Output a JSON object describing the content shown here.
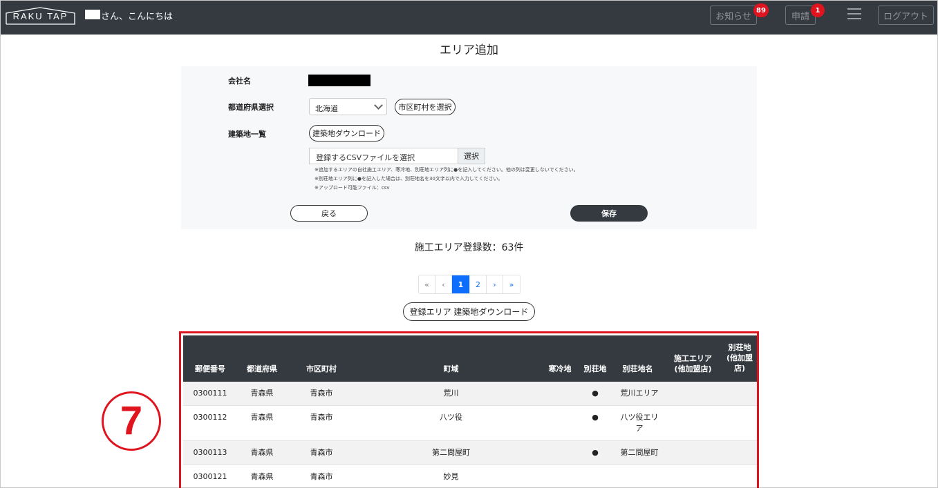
{
  "header": {
    "logo": "RAKU TAP",
    "greeting": "さん、こんにちは",
    "notice_label": "お知らせ",
    "notice_count": "89",
    "apply_label": "申請",
    "apply_count": "1",
    "logout_label": "ログアウト"
  },
  "page_title": "エリア追加",
  "form": {
    "company_label": "会社名",
    "prefecture_label": "都道府県選択",
    "prefecture_value": "北海道",
    "city_button": "市区町村を選択",
    "building_label": "建築地一覧",
    "building_download_button": "建築地ダウンロード",
    "file_placeholder": "登録するCSVファイルを選択",
    "file_button": "選択",
    "notes": [
      "※追加するエリアの自社施工エリア、寒冷地、別荘地エリア列に●を記入してください。他の列は変更しないでください。",
      "※別荘地エリア列に●を記入した場合は、別荘地名を30文字以内で入力してください。",
      "※アップロード可能ファイル：csv"
    ],
    "back_button": "戻る",
    "save_button": "保存"
  },
  "count_text": "施工エリア登録数：63件",
  "pagination": [
    "«",
    "‹",
    "1",
    "2",
    "›",
    "»"
  ],
  "pagination_active": "1",
  "download_registered_button": "登録エリア 建築地ダウンロード",
  "table": {
    "headers": [
      "郵便番号",
      "都道府県",
      "市区町村",
      "町域",
      "寒冷地",
      "別荘地",
      "別荘地名",
      "施工エリア\n(他加盟店)",
      "別荘地\n(他加盟\n店)"
    ],
    "rows": [
      {
        "zip": "0300111",
        "pref": "青森県",
        "city": "青森市",
        "town": "荒川",
        "cold": "",
        "villa": "●",
        "villa_name": "荒川エリア"
      },
      {
        "zip": "0300112",
        "pref": "青森県",
        "city": "青森市",
        "town": "八ツ役",
        "cold": "",
        "villa": "●",
        "villa_name": "八ツ役エリ\nア"
      },
      {
        "zip": "0300113",
        "pref": "青森県",
        "city": "青森市",
        "town": "第二問屋町",
        "cold": "",
        "villa": "●",
        "villa_name": "第二問屋町"
      },
      {
        "zip": "0300121",
        "pref": "青森県",
        "city": "青森市",
        "town": "妙見",
        "cold": "",
        "villa": "",
        "villa_name": ""
      }
    ]
  },
  "annotation_number": "7",
  "colors": {
    "header_bg": "#343a40",
    "badge": "#e0141e",
    "primary": "#0d6efd",
    "highlight": "#e0141e"
  }
}
